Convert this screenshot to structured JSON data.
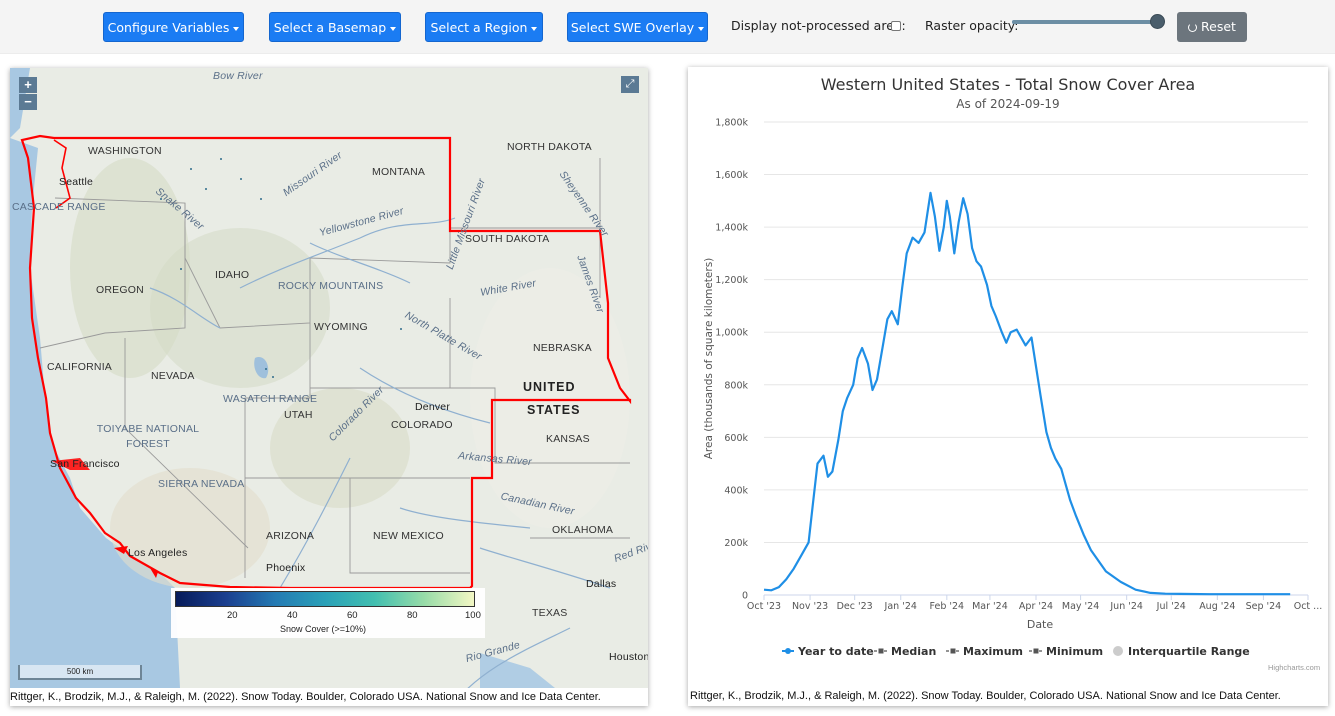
{
  "toolbar": {
    "configure_label": "Configure Variables",
    "basemap_label": "Select a Basemap",
    "region_label": "Select a Region",
    "swe_label": "Select SWE Overlay",
    "not_processed_label": "Display not-processed area:",
    "opacity_label": "Raster opacity:",
    "opacity_value": 1.0,
    "reset_label": "Reset"
  },
  "map": {
    "zoom_in": "+",
    "zoom_out": "−",
    "fullscreen_icon": "⤢",
    "states": [
      "WASHINGTON",
      "MONTANA",
      "NORTH DAKOTA",
      "SOUTH DAKOTA",
      "OREGON",
      "IDAHO",
      "WYOMING",
      "NEBRASKA",
      "CALIFORNIA",
      "NEVADA",
      "UTAH",
      "COLORADO",
      "KANSAS",
      "ARIZONA",
      "NEW MEXICO",
      "OKLAHOMA",
      "TEXAS"
    ],
    "country": [
      "UNITED",
      "STATES"
    ],
    "rivers": [
      "Missouri River",
      "Snake River",
      "Yellowstone River",
      "Little Missouri River",
      "Sheyenne River",
      "James River",
      "White River",
      "North Platte River",
      "Colorado River",
      "Arkansas River",
      "Canadian River",
      "Red River",
      "Rio Grande"
    ],
    "cities": [
      "Seattle",
      "San Francisco",
      "Los Angeles",
      "Phoenix",
      "Denver",
      "Dallas",
      "Houston"
    ],
    "places": [
      "Bow River",
      "CASCADE RANGE",
      "ROCKY MOUNTAINS",
      "WASATCH RANGE",
      "TOIYABE NATIONAL FOREST",
      "SIERRA NEVADA"
    ],
    "legend": {
      "ticks": [
        "20",
        "40",
        "60",
        "80",
        "100"
      ],
      "title": "Snow Cover (>=10%)"
    },
    "scale_label": "500 km",
    "citation": "Rittger, K., Brodzik, M.J., & Raleigh, M. (2022). Snow Today. Boulder, Colorado USA. National Snow and Ice Data Center.",
    "colors": {
      "region_outline": "#ff0000"
    }
  },
  "chart": {
    "citation": "Rittger, K., Brodzik, M.J., & Raleigh, M. (2022). Snow Today. Boulder, Colorado USA. National Snow and Ice Data Center.",
    "credits": "Highcharts.com"
  },
  "chart_data": {
    "type": "line",
    "title": "Western United States - Total Snow Cover Area",
    "subtitle": "As of 2024-09-19",
    "xlabel": "Date",
    "ylabel": "Area (thousands of square kilometers)",
    "ylim": [
      0,
      1800
    ],
    "yticks": [
      0,
      200,
      400,
      600,
      800,
      1000,
      1200,
      1400,
      1600,
      1800
    ],
    "ytick_labels": [
      "0",
      "200k",
      "400k",
      "600k",
      "800k",
      "1,000k",
      "1,200k",
      "1,400k",
      "1,600k",
      "1,800k"
    ],
    "x_tick_labels": [
      "Oct '23",
      "Nov '23",
      "Dec '23",
      "Jan '24",
      "Feb '24",
      "Mar '24",
      "Apr '24",
      "May '24",
      "Jun '24",
      "Jul '24",
      "Aug '24",
      "Sep '24",
      "Oct ..."
    ],
    "x_tick_days": [
      0,
      31,
      61,
      92,
      123,
      152,
      183,
      213,
      244,
      274,
      305,
      336,
      366
    ],
    "xlim": [
      0,
      366
    ],
    "grid": true,
    "legend_position": "bottom-center",
    "colors": {
      "year_to_date": "#1f8fe6",
      "stats": "#555555",
      "iqr": "#cccccc"
    },
    "series": [
      {
        "name": "Year to date",
        "type": "line",
        "x": [
          0,
          5,
          10,
          15,
          20,
          25,
          30,
          33,
          36,
          40,
          43,
          46,
          50,
          53,
          56,
          60,
          63,
          66,
          70,
          73,
          76,
          80,
          83,
          86,
          90,
          93,
          96,
          100,
          104,
          108,
          112,
          115,
          118,
          121,
          123,
          125,
          128,
          131,
          134,
          137,
          140,
          143,
          146,
          150,
          153,
          156,
          160,
          163,
          166,
          170,
          173,
          176,
          180,
          183,
          186,
          190,
          193,
          196,
          200,
          203,
          206,
          210,
          215,
          220,
          225,
          230,
          240,
          250,
          260,
          270,
          280,
          300,
          320,
          340,
          354
        ],
        "values": [
          20,
          18,
          30,
          60,
          100,
          150,
          200,
          350,
          500,
          530,
          450,
          470,
          590,
          700,
          750,
          800,
          900,
          940,
          880,
          780,
          820,
          950,
          1050,
          1080,
          1030,
          1170,
          1300,
          1360,
          1340,
          1380,
          1530,
          1440,
          1310,
          1400,
          1500,
          1440,
          1300,
          1420,
          1510,
          1450,
          1320,
          1270,
          1250,
          1180,
          1100,
          1060,
          1000,
          960,
          1000,
          1010,
          980,
          950,
          980,
          870,
          760,
          620,
          560,
          520,
          480,
          420,
          360,
          300,
          230,
          170,
          130,
          90,
          50,
          20,
          8,
          5,
          4,
          3,
          3,
          3,
          3
        ]
      },
      {
        "name": "Median",
        "type": "line"
      },
      {
        "name": "Maximum",
        "type": "line"
      },
      {
        "name": "Minimum",
        "type": "line"
      },
      {
        "name": "Interquartile Range",
        "type": "area"
      }
    ]
  }
}
